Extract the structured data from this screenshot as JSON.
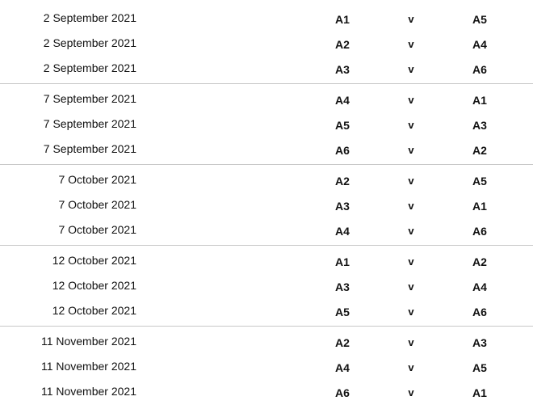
{
  "vs_label": "v",
  "groups": [
    {
      "fixtures": [
        {
          "date": "2 September 2021",
          "home": "A1",
          "away": "A5"
        },
        {
          "date": "2 September 2021",
          "home": "A2",
          "away": "A4"
        },
        {
          "date": "2 September 2021",
          "home": "A3",
          "away": "A6"
        }
      ]
    },
    {
      "fixtures": [
        {
          "date": "7 September 2021",
          "home": "A4",
          "away": "A1"
        },
        {
          "date": "7 September 2021",
          "home": "A5",
          "away": "A3"
        },
        {
          "date": "7 September 2021",
          "home": "A6",
          "away": "A2"
        }
      ]
    },
    {
      "fixtures": [
        {
          "date": "7 October 2021",
          "home": "A2",
          "away": "A5"
        },
        {
          "date": "7 October 2021",
          "home": "A3",
          "away": "A1"
        },
        {
          "date": "7 October 2021",
          "home": "A4",
          "away": "A6"
        }
      ]
    },
    {
      "fixtures": [
        {
          "date": "12 October 2021",
          "home": "A1",
          "away": "A2"
        },
        {
          "date": "12 October 2021",
          "home": "A3",
          "away": "A4"
        },
        {
          "date": "12 October 2021",
          "home": "A5",
          "away": "A6"
        }
      ]
    },
    {
      "fixtures": [
        {
          "date": "11 November 2021",
          "home": "A2",
          "away": "A3"
        },
        {
          "date": "11 November 2021",
          "home": "A4",
          "away": "A5"
        },
        {
          "date": "11 November 2021",
          "home": "A6",
          "away": "A1"
        }
      ]
    }
  ]
}
